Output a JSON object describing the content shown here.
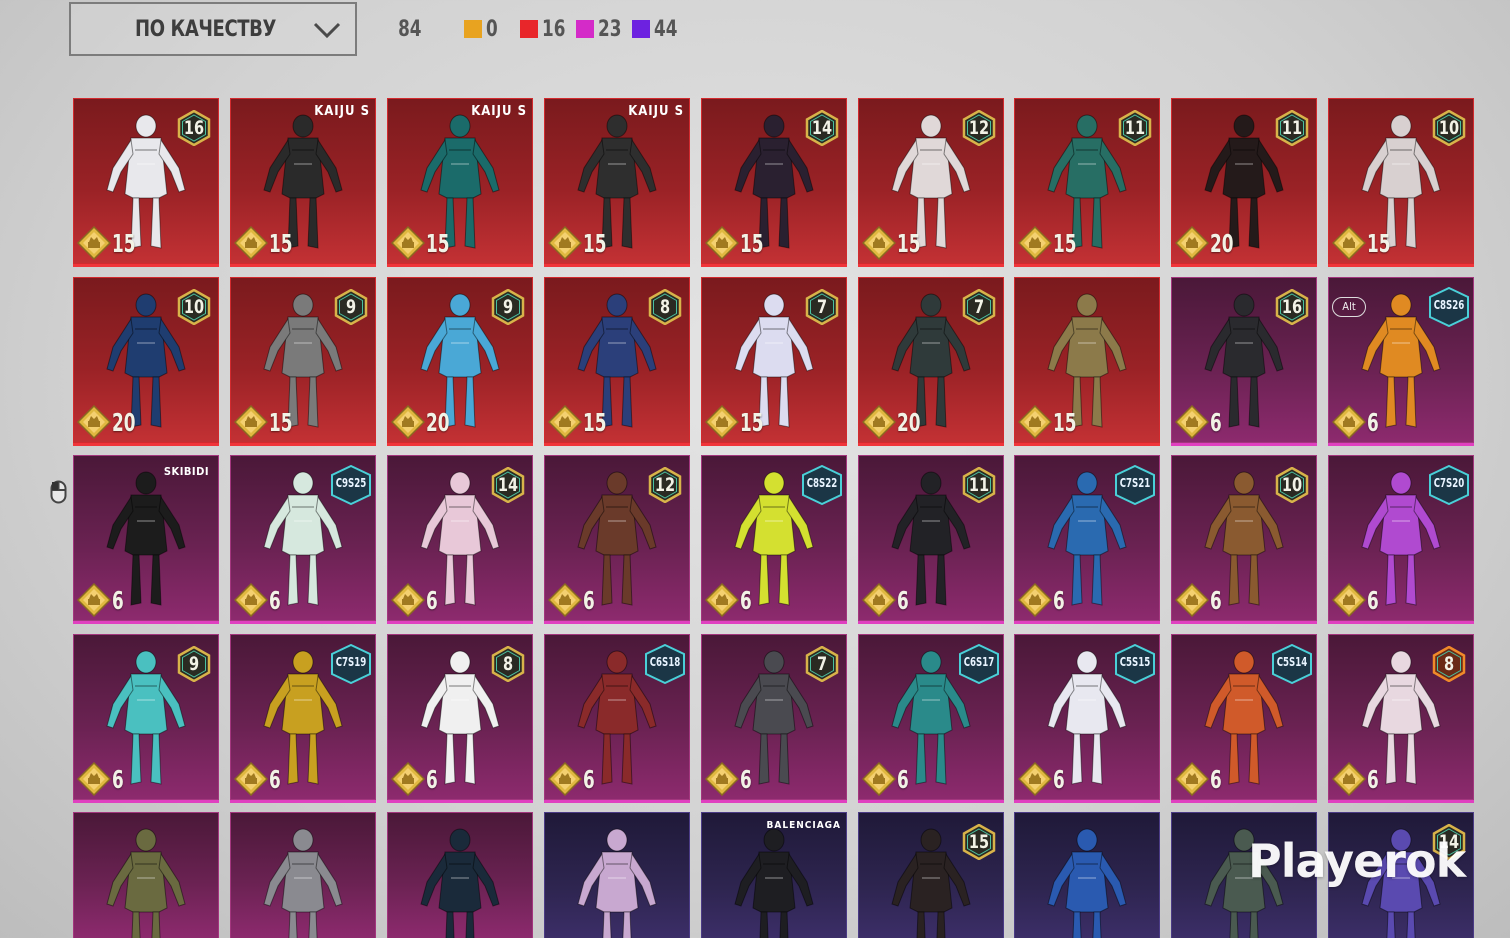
{
  "sort": {
    "label": "ПО КАЧЕСТВУ",
    "icon": "chevron-down-icon"
  },
  "summary": {
    "total": "84",
    "counts": [
      {
        "color": "#e8a320",
        "value": "0"
      },
      {
        "color": "#e8262a",
        "value": "16"
      },
      {
        "color": "#d42bc8",
        "value": "23"
      },
      {
        "color": "#6d22e0",
        "value": "44"
      }
    ]
  },
  "colors": {
    "red": "#f0353a",
    "pink": "#e040c0",
    "violet": "#6a3fd0"
  },
  "items": [
    {
      "rarity": "red",
      "badge": "16",
      "price": "15",
      "tone": "white",
      "hue": "#e8e8ec"
    },
    {
      "rarity": "red",
      "brand": "KAIJU S",
      "price": "15",
      "tone": "black",
      "hue": "#2a2a2a"
    },
    {
      "rarity": "red",
      "brand": "KAIJU S",
      "price": "15",
      "tone": "teal",
      "hue": "#1b6b6a"
    },
    {
      "rarity": "red",
      "brand": "KAIJU S",
      "price": "15",
      "tone": "black",
      "hue": "#2e2e2e"
    },
    {
      "rarity": "red",
      "badge": "14",
      "price": "15",
      "tone": "black",
      "hue": "#2a2030"
    },
    {
      "rarity": "red",
      "badge": "12",
      "price": "15",
      "tone": "white",
      "hue": "#e0d8d8"
    },
    {
      "rarity": "red",
      "badge": "11",
      "price": "15",
      "tone": "teal",
      "hue": "#276e64"
    },
    {
      "rarity": "red",
      "badge": "11",
      "price": "20",
      "tone": "black",
      "hue": "#241a1a"
    },
    {
      "rarity": "red",
      "badge": "10",
      "price": "15",
      "tone": "red",
      "hue": "#d8d0d0"
    },
    {
      "rarity": "red",
      "badge": "10",
      "price": "20",
      "tone": "navy",
      "hue": "#1f3d70"
    },
    {
      "rarity": "red",
      "badge": "9",
      "price": "15",
      "tone": "gray",
      "hue": "#7a7a7a"
    },
    {
      "rarity": "red",
      "badge": "9",
      "price": "20",
      "tone": "blue",
      "hue": "#4aa8d6"
    },
    {
      "rarity": "red",
      "badge": "8",
      "price": "15",
      "tone": "navy",
      "hue": "#2b3f7a"
    },
    {
      "rarity": "red",
      "badge": "7",
      "price": "15",
      "tone": "white",
      "hue": "#dcdcf0"
    },
    {
      "rarity": "red",
      "badge": "7",
      "price": "20",
      "tone": "black",
      "hue": "#2f3a3a"
    },
    {
      "rarity": "red",
      "price": "15",
      "tone": "gold",
      "hue": "#8c7a4a"
    },
    {
      "rarity": "pink",
      "badge": "16",
      "price": "6",
      "tone": "black",
      "hue": "#2a2a2e"
    },
    {
      "rarity": "pink",
      "season": "C8S26",
      "alt": "Alt",
      "price": "6",
      "tone": "orange",
      "hue": "#e08a22"
    },
    {
      "rarity": "pink",
      "brand": "SKIBIDI",
      "price": "6",
      "tone": "black",
      "hue": "#1c1c1c"
    },
    {
      "rarity": "pink",
      "season": "C9S25",
      "price": "6",
      "tone": "mint",
      "hue": "#d6e8de"
    },
    {
      "rarity": "pink",
      "badge": "14",
      "price": "6",
      "tone": "pink",
      "hue": "#e8c8d8"
    },
    {
      "rarity": "pink",
      "badge": "12",
      "price": "6",
      "tone": "orange",
      "hue": "#6a3a2a"
    },
    {
      "rarity": "pink",
      "season": "C8S22",
      "price": "6",
      "tone": "lime",
      "hue": "#d4e030"
    },
    {
      "rarity": "pink",
      "badge": "11",
      "price": "6",
      "tone": "black",
      "hue": "#222226"
    },
    {
      "rarity": "pink",
      "season": "C7S21",
      "price": "6",
      "tone": "gold",
      "hue": "#2a6ab0"
    },
    {
      "rarity": "pink",
      "badge": "10",
      "price": "6",
      "tone": "brown",
      "hue": "#8a5a30"
    },
    {
      "rarity": "pink",
      "season": "C7S20",
      "price": "6",
      "tone": "purple",
      "hue": "#b04ad0"
    },
    {
      "rarity": "pink",
      "badge": "9",
      "price": "6",
      "tone": "cyan",
      "hue": "#4ac0c0"
    },
    {
      "rarity": "pink",
      "season": "C7S19",
      "price": "6",
      "tone": "yellow",
      "hue": "#c8a020"
    },
    {
      "rarity": "pink",
      "badge": "8",
      "price": "6",
      "tone": "white",
      "hue": "#f0f0f0"
    },
    {
      "rarity": "pink",
      "season": "C6S18",
      "price": "6",
      "tone": "red",
      "hue": "#8a2a2a"
    },
    {
      "rarity": "pink",
      "badge": "7",
      "price": "6",
      "tone": "gray",
      "hue": "#4a4a50"
    },
    {
      "rarity": "pink",
      "season": "C6S17",
      "price": "6",
      "tone": "teal",
      "hue": "#2a8a8a"
    },
    {
      "rarity": "pink",
      "season": "C5S15",
      "price": "6",
      "tone": "purple",
      "hue": "#e8e8f0"
    },
    {
      "rarity": "pink",
      "season": "C5S14",
      "price": "6",
      "tone": "orange",
      "hue": "#d05a2a"
    },
    {
      "rarity": "pink",
      "badge": "8",
      "badge_style": "orange",
      "price": "6",
      "tone": "white",
      "hue": "#e8d8e0"
    },
    {
      "rarity": "pink",
      "tone": "gold",
      "hue": "#6a6a40"
    },
    {
      "rarity": "pink",
      "tone": "gray",
      "hue": "#8a8a90"
    },
    {
      "rarity": "pink",
      "tone": "black",
      "hue": "#1a2a3a"
    },
    {
      "rarity": "violet",
      "tone": "pink",
      "hue": "#c8a8d0"
    },
    {
      "rarity": "violet",
      "brand": "BALENCIAGA",
      "tone": "black",
      "hue": "#1e1e22"
    },
    {
      "rarity": "violet",
      "badge": "15",
      "tone": "black",
      "hue": "#2a2222"
    },
    {
      "rarity": "violet",
      "tone": "blue",
      "hue": "#2a5ab0"
    },
    {
      "rarity": "violet",
      "tone": "gray",
      "hue": "#4a5a50"
    },
    {
      "rarity": "violet",
      "badge": "14",
      "tone": "purple",
      "hue": "#5a4ab0"
    }
  ],
  "watermark": "Playerok"
}
